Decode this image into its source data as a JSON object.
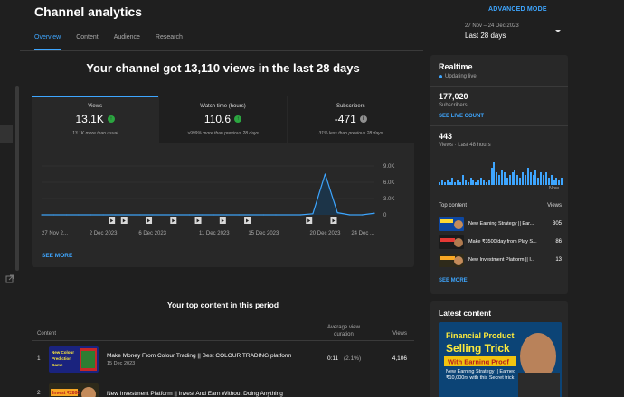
{
  "header": {
    "title": "Channel analytics",
    "advanced_mode": "ADVANCED MODE"
  },
  "tabs": [
    {
      "label": "Overview",
      "active": true
    },
    {
      "label": "Content",
      "active": false
    },
    {
      "label": "Audience",
      "active": false
    },
    {
      "label": "Research",
      "active": false
    }
  ],
  "date_picker": {
    "range": "27 Nov – 24 Dec 2023",
    "label": "Last 28 days"
  },
  "headline": "Your channel got 13,110 views in the last 28 days",
  "metrics": [
    {
      "label": "Views",
      "value": "13.1K",
      "note": "13.1K more than usual",
      "trend": "up",
      "icon": "arrow-up-icon"
    },
    {
      "label": "Watch time (hours)",
      "value": "110.6",
      "note": ">999% more than previous 28 days",
      "trend": "up",
      "icon": "arrow-up-icon"
    },
    {
      "label": "Subscribers",
      "value": "-471",
      "note": "31% less than previous 28 days",
      "trend": "neutral",
      "icon": "info-icon"
    }
  ],
  "see_more": "SEE MORE",
  "chart_data": {
    "type": "area",
    "title": "",
    "x": [
      "27 Nov 2023",
      "28 Nov",
      "29 Nov",
      "30 Nov",
      "1 Dec",
      "2 Dec",
      "3 Dec",
      "4 Dec",
      "5 Dec",
      "6 Dec",
      "7 Dec",
      "8 Dec",
      "9 Dec",
      "10 Dec",
      "11 Dec",
      "12 Dec",
      "13 Dec",
      "14 Dec",
      "15 Dec",
      "16 Dec",
      "17 Dec",
      "18 Dec",
      "19 Dec",
      "20 Dec",
      "21 Dec",
      "22 Dec",
      "23 Dec",
      "24 Dec"
    ],
    "values": [
      0,
      0,
      0,
      0,
      0,
      0,
      0,
      0,
      0,
      0,
      0,
      0,
      0,
      0,
      0,
      0,
      0,
      0,
      0,
      0,
      0,
      0,
      200,
      7500,
      400,
      0,
      0,
      300
    ],
    "tick_labels": [
      "27 Nov 2...",
      "2 Dec 2023",
      "6 Dec 2023",
      "11 Dec 2023",
      "15 Dec 2023",
      "20 Dec 2023",
      "24 Dec ..."
    ],
    "y_ticks": [
      "9.0K",
      "6.0K",
      "3.0K",
      "0"
    ],
    "ylim": [
      0,
      9000
    ],
    "grid": true,
    "colors": {
      "line": "#3ea6ff",
      "area": "#1c3448"
    }
  },
  "video_markers": 9,
  "top_content": {
    "title": "Your top content in this period",
    "columns": {
      "content": "Content",
      "avg_duration": "Average view duration",
      "views": "Views"
    },
    "rows": [
      {
        "index": "1",
        "title": "Make Money From Colour Trading || Best COLOUR TRADING platform",
        "date": "15 Dec 2023",
        "duration": "0:11",
        "pct": "(2.1%)",
        "views": "4,106"
      },
      {
        "index": "2",
        "title": "New Investment Platform || Invest And Earn Without Doing Anything",
        "date": "",
        "duration": "",
        "pct": "",
        "views": ""
      }
    ]
  },
  "realtime": {
    "title": "Realtime",
    "status": "Updating live",
    "subscribers": "177,020",
    "subscribers_label": "Subscribers",
    "see_live": "SEE LIVE COUNT",
    "views": "443",
    "views_label": "Views · Last 48 hours",
    "now": "Now",
    "bars": [
      1,
      2,
      1,
      2,
      1,
      3,
      1,
      2,
      1,
      4,
      2,
      1,
      3,
      2,
      1,
      2,
      3,
      2,
      1,
      2,
      7,
      9,
      5,
      4,
      6,
      5,
      3,
      4,
      5,
      6,
      4,
      3,
      5,
      4,
      7,
      5,
      4,
      6,
      3,
      5,
      4,
      5,
      3,
      4,
      2,
      3,
      2,
      3
    ],
    "top_content_label": "Top content",
    "views_col": "Views",
    "items": [
      {
        "title": "New Earning Strategy || Ear...",
        "views": "305"
      },
      {
        "title": "Make ₹3500/day from Play S...",
        "views": "86"
      },
      {
        "title": "New Investment Platform || I...",
        "views": "13"
      }
    ],
    "see_more": "SEE MORE"
  },
  "latest": {
    "title": "Latest content",
    "thumb_line1": "Financial Product",
    "thumb_line2": "Selling Trick",
    "thumb_line3": "With Earning Proof",
    "thumb_caption": "New Earning Strategy || Earned ₹10,000rs with this Secret trick"
  },
  "thumbs": {
    "row1_line1": "New Colour",
    "row1_line2": "Prediction",
    "row1_line3": "Game",
    "row2_line1": "Invest ₹2800"
  }
}
